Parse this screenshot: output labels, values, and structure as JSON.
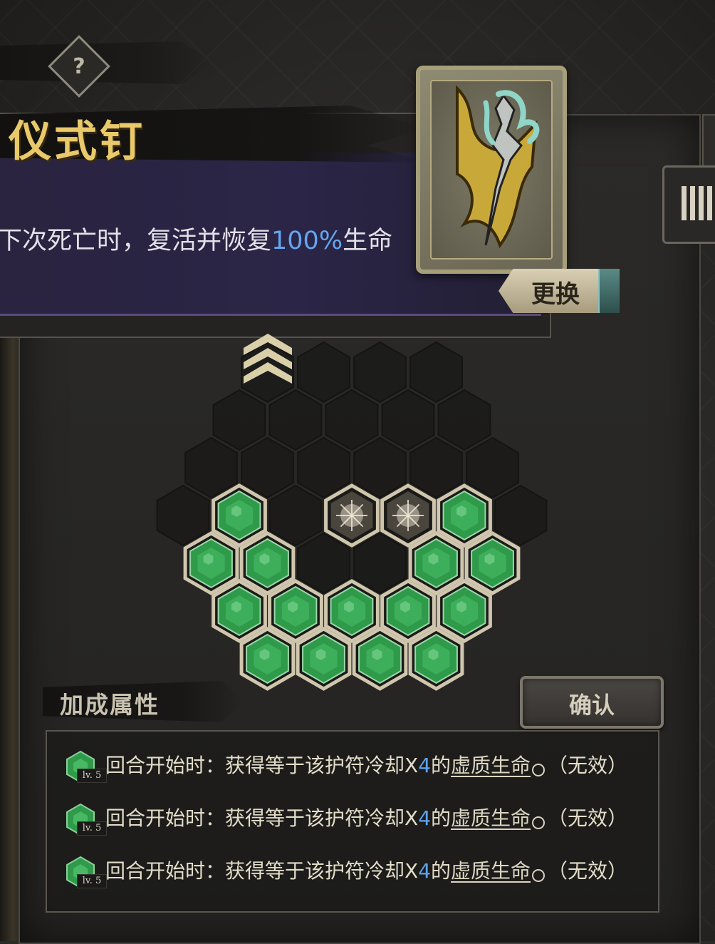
{
  "artifact": {
    "name": "仪式钉",
    "help_symbol": "?",
    "description_pre": "下次死亡时，复活并恢复",
    "description_value": "100%",
    "description_post": "生命"
  },
  "swap_label": "更换",
  "confirm_label": "确认",
  "bonus": {
    "title": "加成属性",
    "items": [
      {
        "level": "lv. 5",
        "prefix": "回合开始时：获得等于该护符冷却X",
        "multiplier": "4",
        "mid": "的",
        "keyword": "虚质生命",
        "suffix": "（无效）"
      },
      {
        "level": "lv. 5",
        "prefix": "回合开始时：获得等于该护符冷却X",
        "multiplier": "4",
        "mid": "的",
        "keyword": "虚质生命",
        "suffix": "（无效）"
      },
      {
        "level": "lv. 5",
        "prefix": "回合开始时：获得等于该护符冷却X",
        "multiplier": "4",
        "mid": "的",
        "keyword": "虚质生命",
        "suffix": "（无效）"
      }
    ]
  },
  "colors": {
    "gem_green": "#2f9a4a",
    "title_gold": "#e9c969",
    "value_blue": "#64a6ef",
    "band_purple": "#2b2547"
  },
  "hex_board": {
    "rows": [
      [
        "upgrade",
        "empty",
        "empty",
        "empty"
      ],
      [
        "empty",
        "empty",
        "empty",
        "empty",
        "empty"
      ],
      [
        "empty",
        "empty",
        "empty",
        "empty",
        "empty",
        "empty"
      ],
      [
        "empty",
        "gem",
        "empty",
        "special",
        "special",
        "gem",
        "empty"
      ],
      [
        "gem",
        "gem",
        "empty",
        "empty",
        "gem",
        "gem"
      ],
      [
        "gem",
        "gem",
        "gem",
        "gem",
        "gem"
      ],
      [
        "gem",
        "gem",
        "gem",
        "gem"
      ]
    ]
  }
}
